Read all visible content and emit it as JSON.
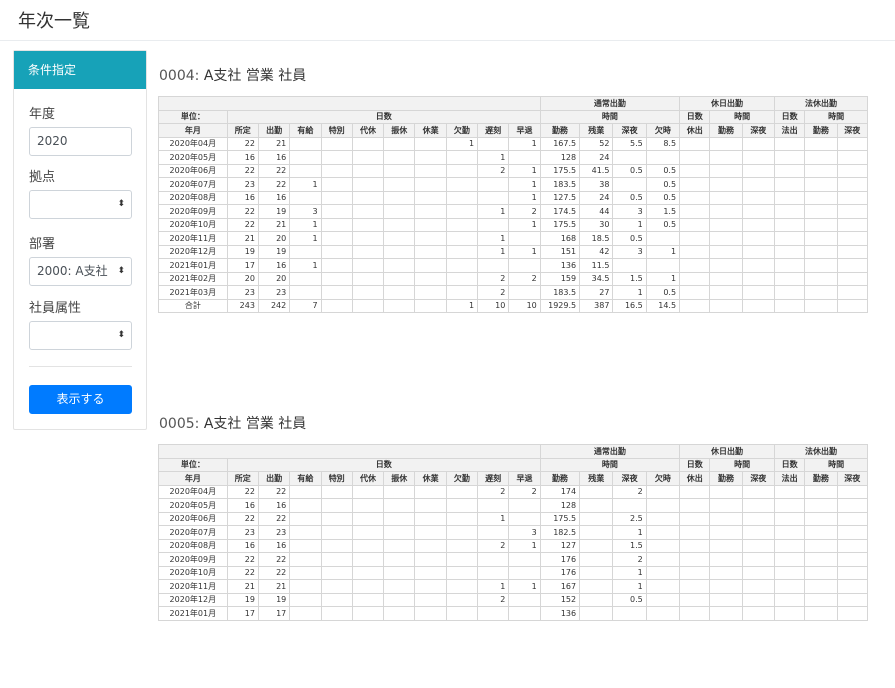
{
  "page": {
    "title": "年次一覧"
  },
  "panel": {
    "header": "条件指定",
    "year_label": "年度",
    "year_value": "2020",
    "base_label": "拠点",
    "base_value": "",
    "dept_label": "部署",
    "dept_value": "2000: A支社",
    "attr_label": "社員属性",
    "attr_value": "",
    "submit_label": "表示する",
    "select_arrow_glyph": "⬍"
  },
  "headers": {
    "top": [
      "通常出勤",
      "休日出勤",
      "法休出勤"
    ],
    "unit": "単位：",
    "days": "日数",
    "hours": "時間",
    "days2": "日数",
    "hours2": "時間",
    "days3": "日数",
    "hours3": "時間",
    "columns": [
      "年月",
      "所定",
      "出勤",
      "有給",
      "特別",
      "代休",
      "振休",
      "休業",
      "欠勤",
      "遅刻",
      "早退",
      "勤務",
      "残業",
      "深夜",
      "欠時",
      "休出",
      "勤務",
      "深夜",
      "法出",
      "勤務",
      "深夜"
    ]
  },
  "sections": [
    {
      "code": "0004:",
      "name": "A支社 営業 社員",
      "rows": [
        [
          "2020年04月",
          "22",
          "21",
          "",
          "",
          "",
          "",
          "",
          "1",
          "",
          "1",
          "167.5",
          "52",
          "5.5",
          "8.5",
          "",
          "",
          "",
          "",
          "",
          ""
        ],
        [
          "2020年05月",
          "16",
          "16",
          "",
          "",
          "",
          "",
          "",
          "",
          "1",
          "",
          "128",
          "24",
          "",
          "",
          "",
          "",
          "",
          "",
          "",
          ""
        ],
        [
          "2020年06月",
          "22",
          "22",
          "",
          "",
          "",
          "",
          "",
          "",
          "2",
          "1",
          "175.5",
          "41.5",
          "0.5",
          "0.5",
          "",
          "",
          "",
          "",
          "",
          ""
        ],
        [
          "2020年07月",
          "23",
          "22",
          "1",
          "",
          "",
          "",
          "",
          "",
          "",
          "1",
          "183.5",
          "38",
          "",
          "0.5",
          "",
          "",
          "",
          "",
          "",
          ""
        ],
        [
          "2020年08月",
          "16",
          "16",
          "",
          "",
          "",
          "",
          "",
          "",
          "",
          "1",
          "127.5",
          "24",
          "0.5",
          "0.5",
          "",
          "",
          "",
          "",
          "",
          ""
        ],
        [
          "2020年09月",
          "22",
          "19",
          "3",
          "",
          "",
          "",
          "",
          "",
          "1",
          "2",
          "174.5",
          "44",
          "3",
          "1.5",
          "",
          "",
          "",
          "",
          "",
          ""
        ],
        [
          "2020年10月",
          "22",
          "21",
          "1",
          "",
          "",
          "",
          "",
          "",
          "",
          "1",
          "175.5",
          "30",
          "1",
          "0.5",
          "",
          "",
          "",
          "",
          "",
          ""
        ],
        [
          "2020年11月",
          "21",
          "20",
          "1",
          "",
          "",
          "",
          "",
          "",
          "1",
          "",
          "168",
          "18.5",
          "0.5",
          "",
          "",
          "",
          "",
          "",
          "",
          ""
        ],
        [
          "2020年12月",
          "19",
          "19",
          "",
          "",
          "",
          "",
          "",
          "",
          "1",
          "1",
          "151",
          "42",
          "3",
          "1",
          "",
          "",
          "",
          "",
          "",
          ""
        ],
        [
          "2021年01月",
          "17",
          "16",
          "1",
          "",
          "",
          "",
          "",
          "",
          "",
          "",
          "136",
          "11.5",
          "",
          "",
          "",
          "",
          "",
          "",
          "",
          ""
        ],
        [
          "2021年02月",
          "20",
          "20",
          "",
          "",
          "",
          "",
          "",
          "",
          "2",
          "2",
          "159",
          "34.5",
          "1.5",
          "1",
          "",
          "",
          "",
          "",
          "",
          ""
        ],
        [
          "2021年03月",
          "23",
          "23",
          "",
          "",
          "",
          "",
          "",
          "",
          "2",
          "",
          "183.5",
          "27",
          "1",
          "0.5",
          "",
          "",
          "",
          "",
          "",
          ""
        ],
        [
          "合計",
          "243",
          "242",
          "7",
          "",
          "",
          "",
          "",
          "1",
          "10",
          "10",
          "1929.5",
          "387",
          "16.5",
          "14.5",
          "",
          "",
          "",
          "",
          "",
          ""
        ]
      ]
    },
    {
      "code": "0005:",
      "name": "A支社 営業 社員",
      "rows": [
        [
          "2020年04月",
          "22",
          "22",
          "",
          "",
          "",
          "",
          "",
          "",
          "2",
          "2",
          "174",
          "",
          "2",
          "",
          "",
          "",
          "",
          "",
          "",
          ""
        ],
        [
          "2020年05月",
          "16",
          "16",
          "",
          "",
          "",
          "",
          "",
          "",
          "",
          "",
          "128",
          "",
          "",
          "",
          "",
          "",
          "",
          "",
          "",
          ""
        ],
        [
          "2020年06月",
          "22",
          "22",
          "",
          "",
          "",
          "",
          "",
          "",
          "1",
          "",
          "175.5",
          "",
          "2.5",
          "",
          "",
          "",
          "",
          "",
          "",
          ""
        ],
        [
          "2020年07月",
          "23",
          "23",
          "",
          "",
          "",
          "",
          "",
          "",
          "",
          "3",
          "182.5",
          "",
          "1",
          "",
          "",
          "",
          "",
          "",
          "",
          ""
        ],
        [
          "2020年08月",
          "16",
          "16",
          "",
          "",
          "",
          "",
          "",
          "",
          "2",
          "1",
          "127",
          "",
          "1.5",
          "",
          "",
          "",
          "",
          "",
          "",
          ""
        ],
        [
          "2020年09月",
          "22",
          "22",
          "",
          "",
          "",
          "",
          "",
          "",
          "",
          "",
          "176",
          "",
          "2",
          "",
          "",
          "",
          "",
          "",
          "",
          ""
        ],
        [
          "2020年10月",
          "22",
          "22",
          "",
          "",
          "",
          "",
          "",
          "",
          "",
          "",
          "176",
          "",
          "1",
          "",
          "",
          "",
          "",
          "",
          "",
          ""
        ],
        [
          "2020年11月",
          "21",
          "21",
          "",
          "",
          "",
          "",
          "",
          "",
          "1",
          "1",
          "167",
          "",
          "1",
          "",
          "",
          "",
          "",
          "",
          "",
          ""
        ],
        [
          "2020年12月",
          "19",
          "19",
          "",
          "",
          "",
          "",
          "",
          "",
          "2",
          "",
          "152",
          "",
          "0.5",
          "",
          "",
          "",
          "",
          "",
          "",
          ""
        ],
        [
          "2021年01月",
          "17",
          "17",
          "",
          "",
          "",
          "",
          "",
          "",
          "",
          "",
          "136",
          "",
          "",
          "",
          "",
          "",
          "",
          "",
          "",
          ""
        ]
      ]
    }
  ]
}
